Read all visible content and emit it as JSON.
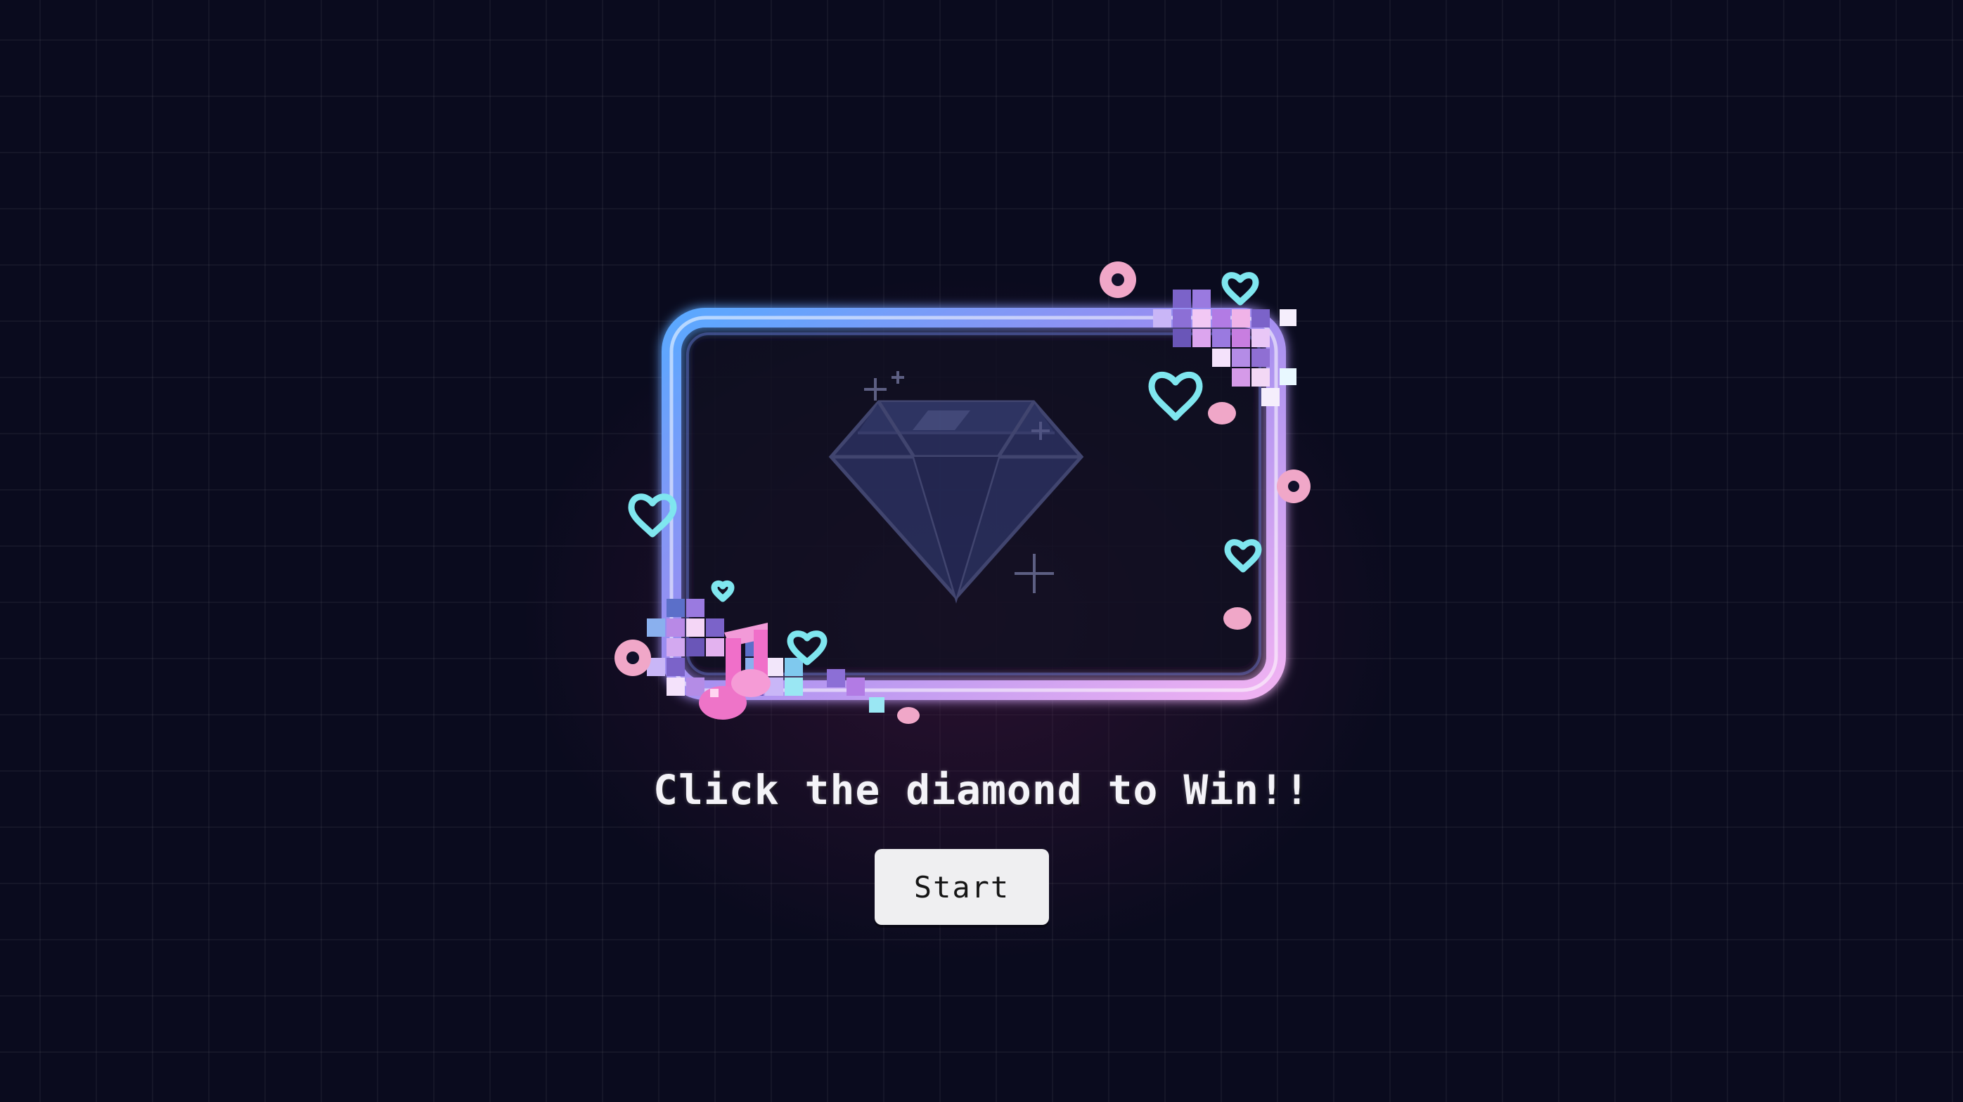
{
  "game": {
    "instruction": "Click the diamond to Win!!",
    "start_label": "Start"
  },
  "colors": {
    "background": "#0a0b1e",
    "frame_blue": "#6ea6ff",
    "frame_pink": "#e7a6f0",
    "heart_cyan": "#7fe6ef",
    "heart_pink": "#f0a7c8",
    "button_bg": "#efeff1",
    "diamond": "#2a3058"
  },
  "icons": {
    "gem": "diamond-icon",
    "hearts": "heart-icon",
    "music": "music-note-icon",
    "sparkle": "sparkle-icon"
  }
}
